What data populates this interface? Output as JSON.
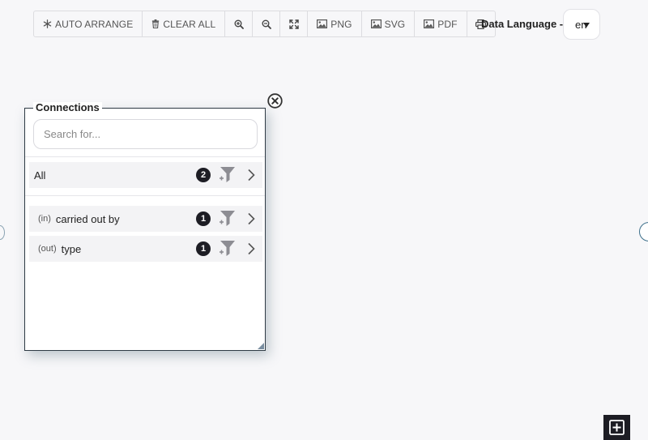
{
  "toolbar": {
    "auto_arrange": "AUTO ARRANGE",
    "clear_all": "CLEAR ALL",
    "png": "PNG",
    "svg": "SVG",
    "pdf": "PDF"
  },
  "language": {
    "label": "Data Language -",
    "selected": "en"
  },
  "panel": {
    "title": "Connections",
    "search_placeholder": "Search for...",
    "all_row": {
      "label": "All",
      "count": "2"
    },
    "connections": [
      {
        "direction": "(in)",
        "label": "carried out by",
        "count": "1"
      },
      {
        "direction": "(out)",
        "label": "type",
        "count": "1"
      }
    ]
  },
  "icons": {
    "auto_arrange": "snowflake-icon",
    "clear_all": "trash-icon",
    "zoom_in": "zoom-in-icon",
    "zoom_out": "zoom-out-icon",
    "fit": "expand-icon",
    "image": "image-icon",
    "print": "print-icon",
    "filter": "filter-add-icon",
    "chevron": "chevron-right-icon",
    "close": "close-circle-icon",
    "add": "plus-square-icon"
  },
  "colors": {
    "background": "#f7f7f9",
    "panel_border": "#2f3b45",
    "badge": "#1d1d24",
    "row_bg": "#f3f3f5"
  }
}
